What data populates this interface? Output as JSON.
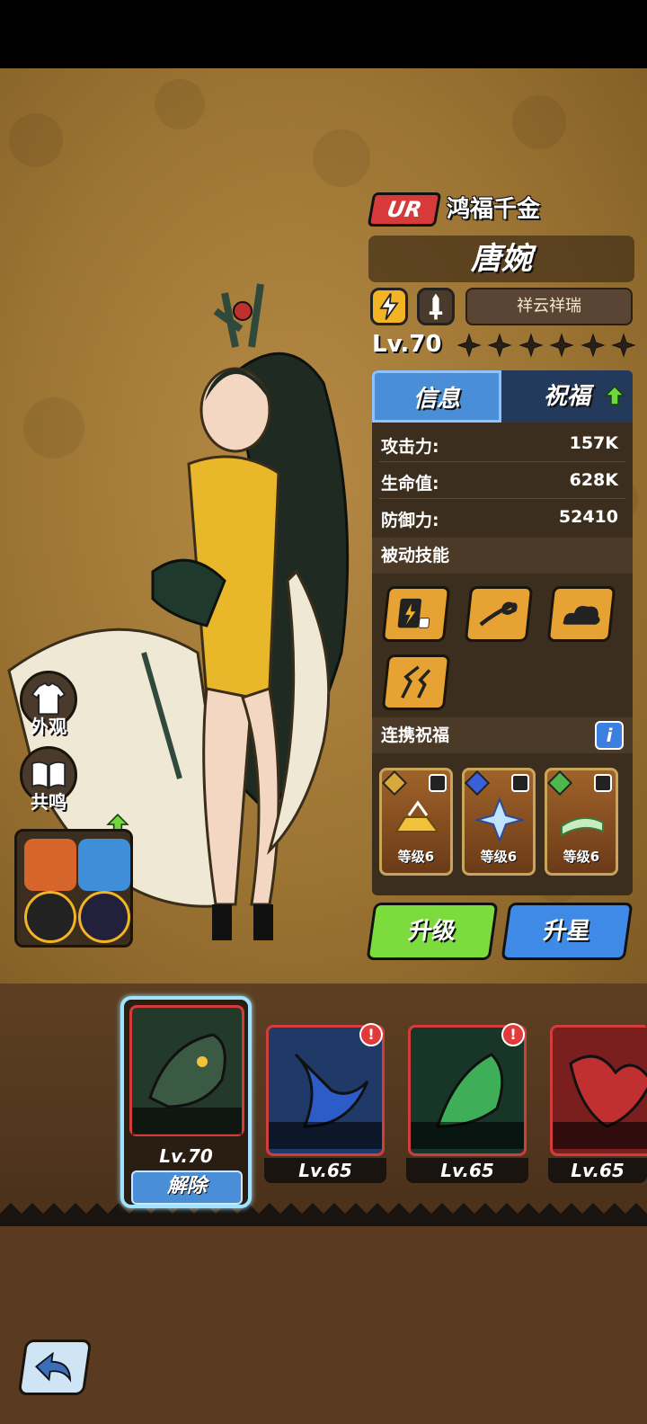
{
  "header": {
    "rarity": "UR",
    "title": "鸿福千金",
    "hero_name": "唐婉",
    "skin_name": "祥云祥瑞",
    "level": "Lv.70",
    "star_count": 6
  },
  "tabs": {
    "info": "信息",
    "bless": "祝福"
  },
  "stats": [
    {
      "label": "攻击力:",
      "value": "157K"
    },
    {
      "label": "生命值:",
      "value": "628K"
    },
    {
      "label": "防御力:",
      "value": "52410"
    }
  ],
  "sections": {
    "passive_skills": "被动技能",
    "linked_blessings": "连携祝福",
    "info_icon": "i"
  },
  "blessings": [
    {
      "level": "等级6",
      "color": "#f2c33a"
    },
    {
      "level": "等级6",
      "color": "#6fa8ff"
    },
    {
      "level": "等级6",
      "color": "#a8e0a0"
    }
  ],
  "actions": {
    "upgrade": "升级",
    "star_up": "升星"
  },
  "side": {
    "appearance": "外观",
    "resonance": "共鸣"
  },
  "pets": [
    {
      "color": "#d5652a"
    },
    {
      "color": "#3e8fd8"
    },
    {
      "color": "#222222"
    },
    {
      "color": "#22203a"
    }
  ],
  "mounts": [
    {
      "level": "Lv.70",
      "selected": true,
      "action": "解除",
      "color": "#233a2a"
    },
    {
      "level": "Lv.65",
      "selected": false,
      "alert": "!",
      "color": "#1f3a66"
    },
    {
      "level": "Lv.65",
      "selected": false,
      "alert": "!",
      "color": "#173628"
    },
    {
      "level": "Lv.65",
      "selected": false,
      "color": "#7a1e1e"
    }
  ],
  "colors": {
    "accent_blue": "#4a8ed8",
    "rarity_red": "#d63a3a",
    "upgrade_green": "#7ddc3d"
  }
}
